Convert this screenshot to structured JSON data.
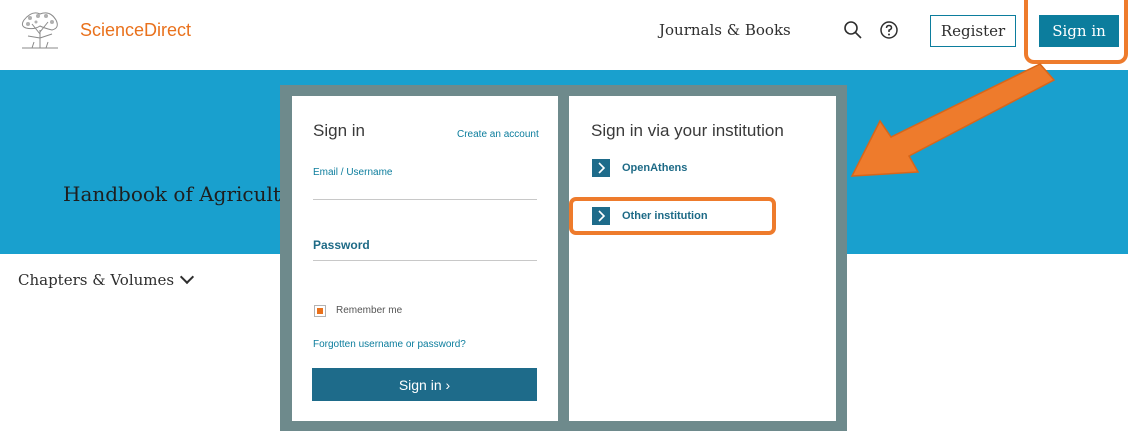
{
  "header": {
    "brand": "ScienceDirect",
    "nav_link": "Journals & Books",
    "register_label": "Register",
    "signin_label": "Sign in"
  },
  "banner": {
    "book_title": "Handbook of Agricult"
  },
  "content": {
    "chapters_label": "Chapters & Volumes"
  },
  "signin_panel": {
    "title": "Sign in",
    "create_account": "Create an account",
    "email_label": "Email / Username",
    "email_value": "",
    "password_label": "Password",
    "password_value": "",
    "remember_label": "Remember me",
    "forgot_link": "Forgotten username or password?",
    "submit_label": "Sign in ›"
  },
  "institution_panel": {
    "title": "Sign in via your institution",
    "options": [
      {
        "label": "OpenAthens"
      },
      {
        "label": "Other institution"
      }
    ]
  },
  "colors": {
    "brand_orange": "#e9711c",
    "accent_blue": "#0c7d9d",
    "banner_blue": "#19a0ce",
    "annotation_orange": "#ee7b2c"
  }
}
